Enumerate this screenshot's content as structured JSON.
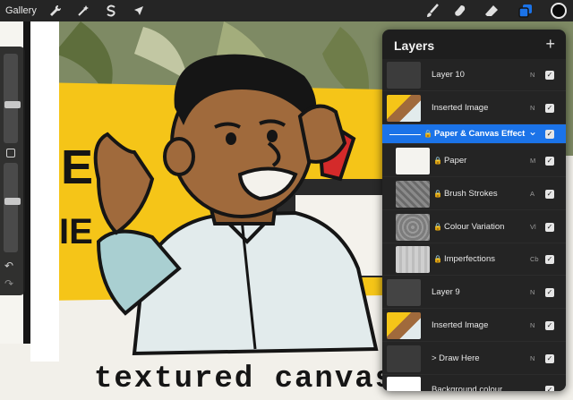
{
  "toolbar": {
    "gallery_label": "Gallery",
    "left_tools": [
      "wrench-icon",
      "magic-wand-icon",
      "selection-s-icon",
      "arrow-cursor-icon"
    ],
    "right_tools": [
      "brush-icon",
      "smudge-icon",
      "eraser-icon",
      "layers-icon",
      "color-swatch"
    ],
    "current_color": "#0a0a0a",
    "accent": "#1b73e8"
  },
  "sidebar": {
    "brush_size_percent": 42,
    "opacity_percent": 58,
    "icons": [
      "modify-square-icon",
      "undo-icon",
      "redo-icon"
    ]
  },
  "artwork": {
    "caption": "textured canvas",
    "sign_letters": [
      "E",
      "IE"
    ],
    "colors": {
      "yellow": "#f5c518",
      "skin": "#a06a3c",
      "shirt": "#dfe8ea",
      "outline": "#151515",
      "phone": "#d42a2a"
    }
  },
  "layers": {
    "title": "Layers",
    "add_label": "+",
    "items": [
      {
        "name": "Layer 10",
        "blend": "N",
        "visible": true,
        "locked": false,
        "child": false,
        "selected": false,
        "thumb": "layer10"
      },
      {
        "name": "Inserted Image",
        "blend": "N",
        "visible": true,
        "locked": false,
        "child": false,
        "selected": false,
        "thumb": "image"
      },
      {
        "name": "Paper & Canvas Effect",
        "blend": "",
        "visible": true,
        "locked": true,
        "child": false,
        "selected": true,
        "group": true,
        "thumb": "group"
      },
      {
        "name": "Paper",
        "blend": "M",
        "visible": true,
        "locked": true,
        "child": true,
        "selected": false,
        "thumb": "paper"
      },
      {
        "name": "Brush Strokes",
        "blend": "A",
        "visible": true,
        "locked": true,
        "child": true,
        "selected": false,
        "thumb": "strokes"
      },
      {
        "name": "Colour Variation",
        "blend": "Vl",
        "visible": true,
        "locked": true,
        "child": true,
        "selected": false,
        "thumb": "variation"
      },
      {
        "name": "Imperfections",
        "blend": "Cb",
        "visible": true,
        "locked": true,
        "child": true,
        "selected": false,
        "thumb": "imperfections"
      },
      {
        "name": "Layer 9",
        "blend": "N",
        "visible": true,
        "locked": false,
        "child": false,
        "selected": false,
        "thumb": "layer9"
      },
      {
        "name": "Inserted Image",
        "blend": "N",
        "visible": true,
        "locked": false,
        "child": false,
        "selected": false,
        "thumb": "image"
      },
      {
        "name": "> Draw Here",
        "blend": "N",
        "visible": true,
        "locked": false,
        "child": false,
        "selected": false,
        "thumb": "draw"
      },
      {
        "name": "Background colour",
        "blend": "",
        "visible": true,
        "locked": false,
        "child": false,
        "selected": false,
        "thumb": "background"
      }
    ]
  }
}
